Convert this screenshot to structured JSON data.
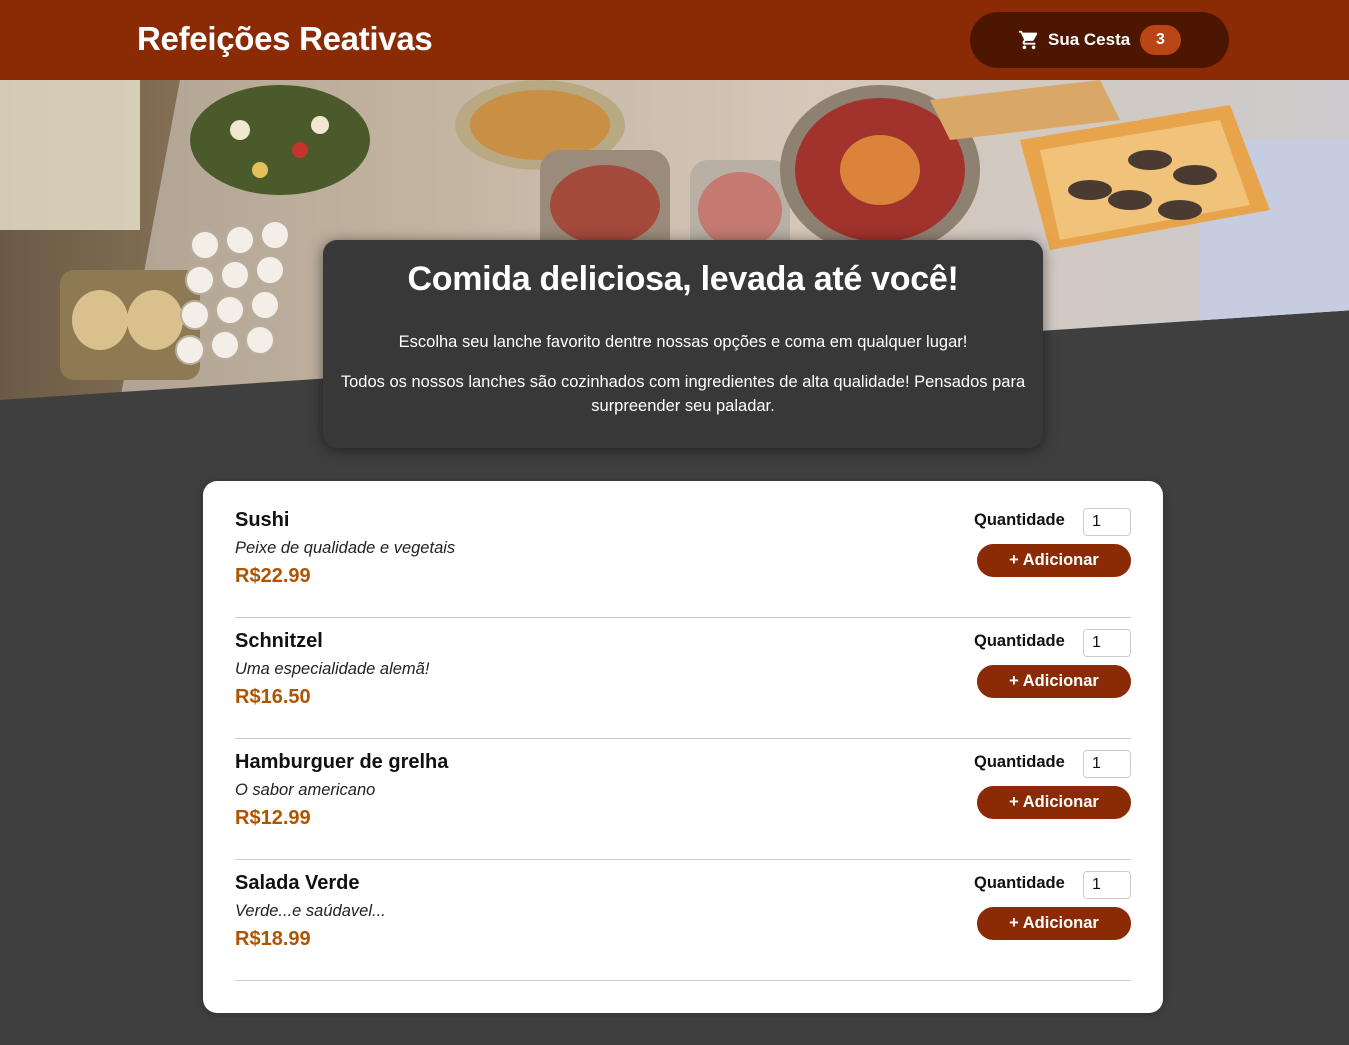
{
  "header": {
    "brand": "Refeições Reativas",
    "cart": {
      "label": "Sua Cesta",
      "count": "3",
      "icon": "cart-icon"
    }
  },
  "summary": {
    "title": "Comida deliciosa, levada até você!",
    "paragraph1": "Escolha seu lanche favorito dentre nossas opções e coma em qualquer lugar!",
    "paragraph2": "Todos os nossos lanches são cozinhados com ingredientes de alta qualidade! Pensados para surpreender seu paladar."
  },
  "meals": [
    {
      "name": "Sushi",
      "description": "Peixe de qualidade e vegetais",
      "price": "R$22.99",
      "qty_label": "Quantidade",
      "qty_value": "1",
      "add_label": "+ Adicionar"
    },
    {
      "name": "Schnitzel",
      "description": "Uma especialidade alemã!",
      "price": "R$16.50",
      "qty_label": "Quantidade",
      "qty_value": "1",
      "add_label": "+ Adicionar"
    },
    {
      "name": "Hamburguer de grelha",
      "description": "O sabor americano",
      "price": "R$12.99",
      "qty_label": "Quantidade",
      "qty_value": "1",
      "add_label": "+ Adicionar"
    },
    {
      "name": "Salada Verde",
      "description": "Verde...e saúdavel...",
      "price": "R$18.99",
      "qty_label": "Quantidade",
      "qty_value": "1",
      "add_label": "+ Adicionar"
    }
  ],
  "colors": {
    "header": "#8a2b06",
    "cart_button": "#4d1601",
    "badge": "#b94517",
    "background": "#3f3f3f",
    "price": "#ad5502"
  }
}
